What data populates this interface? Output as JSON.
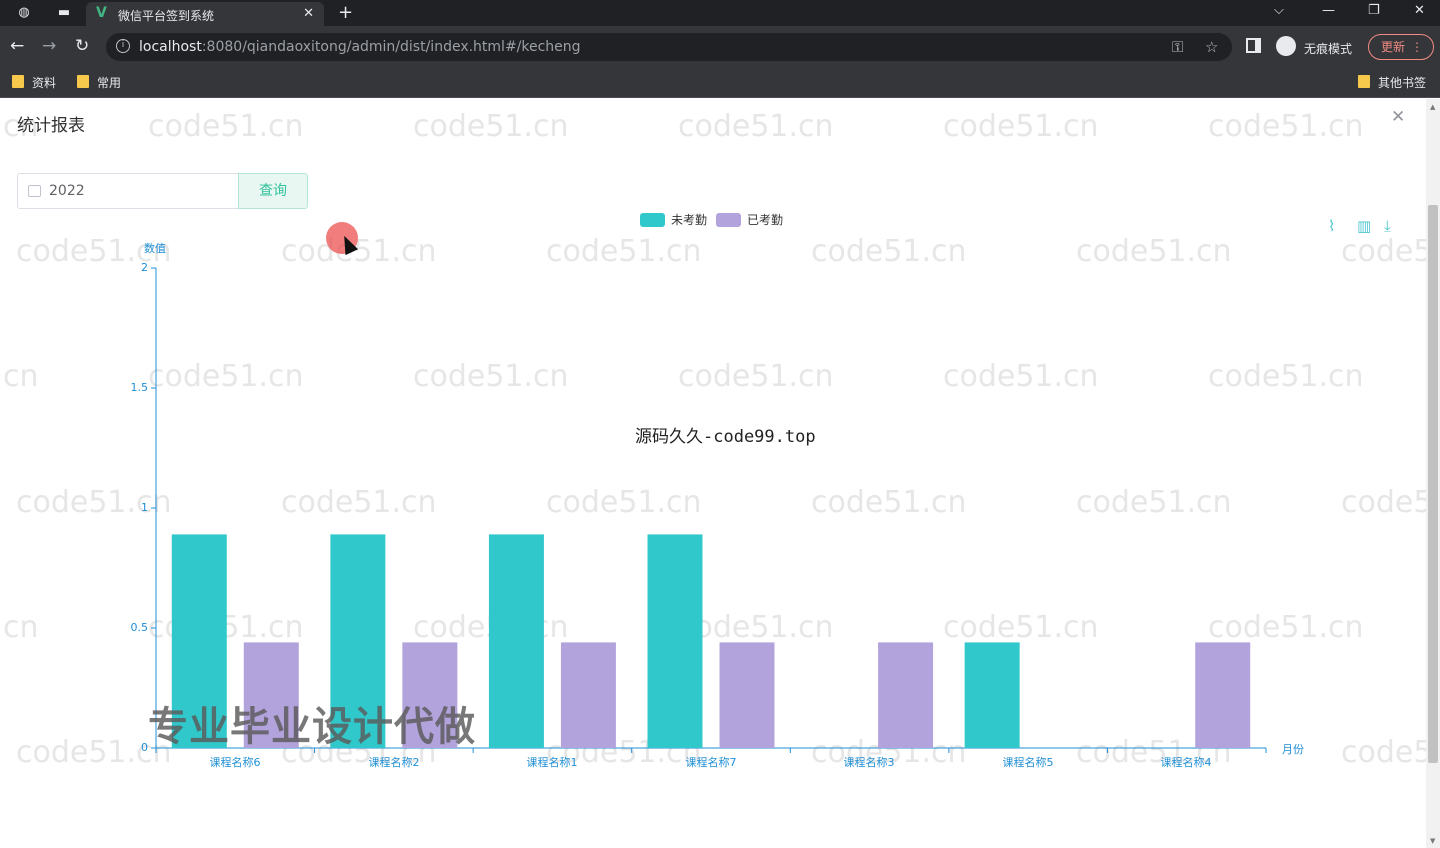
{
  "browser": {
    "tab_title": "微信平台签到系统",
    "url_host": "localhost",
    "url_rest": ":8080/qiandaoxitong/admin/dist/index.html#/kecheng",
    "incognito_label": "无痕模式",
    "update_label": "更新",
    "bookmarks": [
      "资料",
      "常用"
    ],
    "other_bookmarks": "其他书签"
  },
  "dialog": {
    "title": "统计报表",
    "year_value": "2022",
    "query_button": "查询"
  },
  "chart_data": {
    "type": "bar",
    "categories": [
      "课程名称6",
      "课程名称2",
      "课程名称1",
      "课程名称7",
      "课程名称3",
      "课程名称5",
      "课程名称4"
    ],
    "series": [
      {
        "name": "未考勤",
        "color": "#30c8ca",
        "values": [
          0.89,
          0.89,
          0.89,
          0.89,
          0,
          0.44,
          0
        ]
      },
      {
        "name": "已考勤",
        "color": "#b3a3dc",
        "values": [
          0.44,
          0.44,
          0.44,
          0.44,
          0.44,
          0,
          0.44
        ]
      }
    ],
    "ylabel": "数值",
    "xlabel": "月份",
    "ylim": [
      0,
      2
    ],
    "yticks": [
      "0",
      "0.5",
      "1",
      "1.5",
      "2"
    ],
    "legend_position": "top-center",
    "toolbox_icons": [
      "line-chart-icon",
      "bar-chart-icon",
      "download-icon"
    ]
  },
  "watermarks": {
    "repeat_text": "code51.cn",
    "center_text": "源码久久-code99.top",
    "overlay_text": "专业毕业设计代做"
  }
}
